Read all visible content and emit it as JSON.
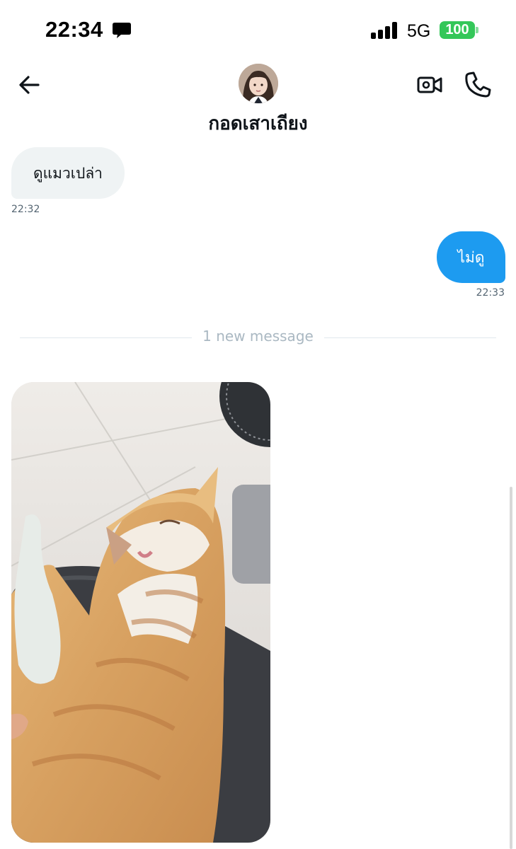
{
  "status_bar": {
    "time": "22:34",
    "network": "5G",
    "battery": "100",
    "battery_color": "#34c759"
  },
  "header": {
    "contact_name": "กอดเสาเถียง",
    "icons": [
      "back-arrow-icon",
      "video-camera-icon",
      "phone-icon"
    ]
  },
  "messages": [
    {
      "direction": "incoming",
      "text": "ดูแมวเปล่า",
      "time": "22:32"
    },
    {
      "direction": "outgoing",
      "text": "ไม่ดู",
      "time": "22:33"
    }
  ],
  "divider": {
    "label": "1 new message"
  },
  "colors": {
    "accent": "#1d9bf0",
    "incoming_bubble": "#eff3f4",
    "muted_text": "#536471"
  }
}
